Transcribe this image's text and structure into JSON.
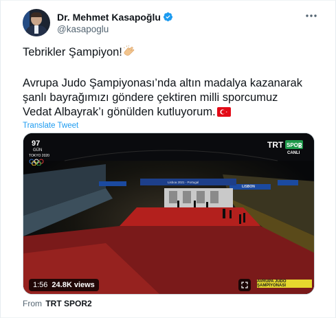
{
  "author": {
    "name": "Dr. Mehmet Kasapoğlu",
    "handle": "@kasapoglu",
    "verified": true
  },
  "tweet": {
    "line1": "Tebrikler Şampiyon!",
    "line2": "Avrupa Judo Şampiyonası’nda altın madalya kazanarak",
    "line3": "şanlı bayrağımızı göndere çektiren milli sporcumuz",
    "line4": "Vedat Albayrak’ı gönülden kutluyorum.",
    "emoji_after_line1": "clapping-hands",
    "emoji_after_line4": "turkey-flag",
    "translate_label": "Translate Tweet"
  },
  "video": {
    "countdown_number": "97",
    "countdown_label": "GÜN",
    "tokyo_label": "TOKYO 2020",
    "channel_logo": "TRT SPOR2",
    "channel_trt": "TRT",
    "channel_spor": "SPOR",
    "channel_num": "2",
    "live_label": "CANLI",
    "duration": "1:56",
    "views": "24.8K views",
    "banner": "AVRUPA JUDO ŞAMPİYONASI",
    "arena_banner": "Lisboa 2021 - Portugal",
    "arena_sign": "LISBON"
  },
  "source": {
    "prefix": "From",
    "name": "TRT SPOR2"
  },
  "colors": {
    "accent": "#1d9bf0",
    "text": "#0f1419",
    "secondary": "#536471",
    "banner": "#e6d82e",
    "floor": "#b3201d"
  }
}
